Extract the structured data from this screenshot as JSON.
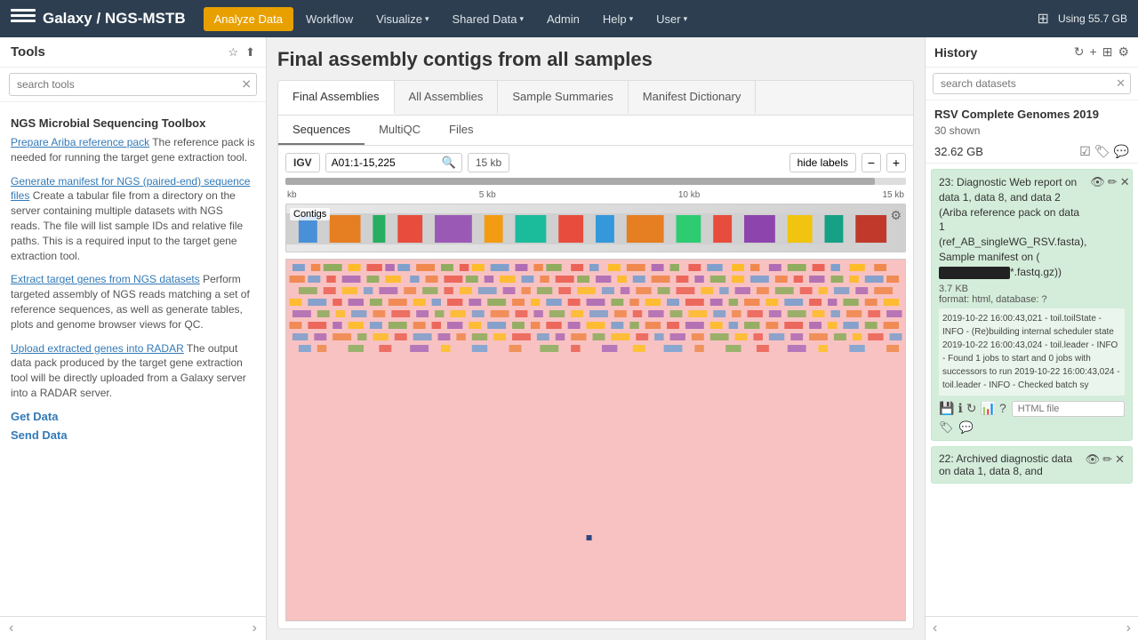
{
  "navbar": {
    "brand": "Galaxy / NGS-MSTB",
    "logo_lines": 3,
    "nav_items": [
      {
        "label": "Analyze Data",
        "active": true
      },
      {
        "label": "Workflow",
        "dropdown": false
      },
      {
        "label": "Visualize",
        "dropdown": true
      },
      {
        "label": "Shared Data",
        "dropdown": true
      },
      {
        "label": "Admin",
        "dropdown": false
      },
      {
        "label": "Help",
        "dropdown": true
      },
      {
        "label": "User",
        "dropdown": true
      }
    ],
    "storage_label": "Using 55.7 GB"
  },
  "sidebar": {
    "title": "Tools",
    "search_placeholder": "search tools",
    "tools": [
      {
        "link": "Prepare Ariba reference pack",
        "desc": " The reference pack is needed for running the target gene extraction tool."
      },
      {
        "link": "Generate manifest for NGS (paired-end) sequence files",
        "desc": " Create a tabular file from a directory on the server containing multiple datasets with NGS reads. The file will list sample IDs and relative file paths. This is a required input to the target gene extraction tool."
      },
      {
        "link": "Extract target genes from NGS datasets",
        "desc": " Perform targeted assembly of NGS reads matching a set of reference sequences, as well as generate tables, plots and genome browser views for QC."
      },
      {
        "link": "Upload extracted genes into RADAR",
        "desc": " The output data pack produced by the target gene extraction tool will be directly uploaded from a Galaxy server into a RADAR server."
      }
    ],
    "categories": [
      "Get Data",
      "Send Data"
    ]
  },
  "main": {
    "page_title": "Final assembly contigs from all samples",
    "tabs": [
      {
        "label": "Final Assemblies",
        "active": true
      },
      {
        "label": "All Assemblies"
      },
      {
        "label": "Sample Summaries"
      },
      {
        "label": "Manifest Dictionary"
      }
    ],
    "sub_tabs": [
      {
        "label": "Sequences",
        "active": true
      },
      {
        "label": "MultiQC"
      },
      {
        "label": "Files"
      }
    ],
    "igv": {
      "label": "IGV",
      "location": "A01:1-15,225",
      "size": "15 kb",
      "hide_labels": "hide labels",
      "ruler_marks": [
        "kb",
        "5 kb",
        "10 kb",
        "15 kb"
      ],
      "track_label": "Contigs",
      "zoom_minus": "−",
      "zoom_plus": "+"
    }
  },
  "history": {
    "title": "History",
    "search_placeholder": "search datasets",
    "history_name": "RSV Complete Genomes 2019",
    "shown": "30 shown",
    "size": "32.62 GB",
    "size_icons": [
      "checkbox",
      "tag",
      "comment"
    ],
    "item23": {
      "number": "23:",
      "title": "Diagnostic Web report on data 1, data 8, and data 2 (Ariba reference pack on data 1 (ref_AB_singleWG_RSV.fasta), Sample manifest on (",
      "redacted": "██████████████",
      "title_end": "*.fastq.gz))",
      "size": "3.7 KB",
      "format": "format: html, database: ?",
      "log": "2019-10-22 16:00:43,021 - toil.toilState - INFO - (Re)building internal scheduler state\n2019-10-22 16:00:43,024 - toil.leader - INFO - Found 1 jobs to start and 0 jobs with successors to run\n2019-10-22 16:00:43,024 - toil.leader - INFO - Checked batch sy",
      "icons": [
        "eye",
        "pencil",
        "times"
      ],
      "action_icons": [
        "save",
        "info",
        "refresh",
        "chart",
        "question"
      ],
      "input_placeholder": "HTML file"
    },
    "item22": {
      "number": "22:",
      "title": "Archived diagnostic data on data 1, data 8, and",
      "icons": [
        "eye",
        "pencil",
        "times"
      ]
    }
  }
}
